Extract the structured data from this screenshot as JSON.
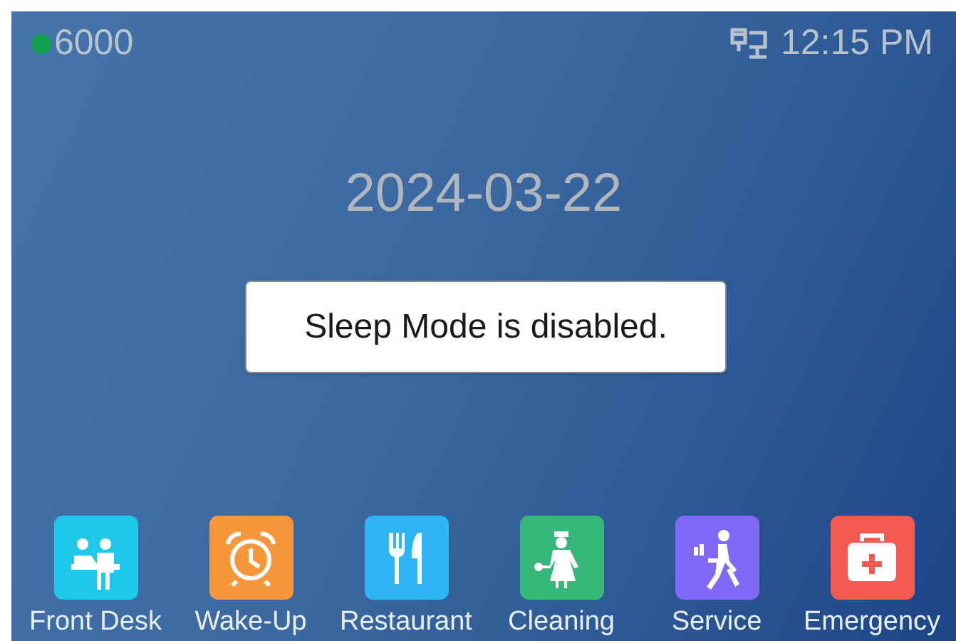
{
  "status_bar": {
    "registered": true,
    "extension": "6000",
    "time": "12:15 PM"
  },
  "date": "2024-03-22",
  "toast": "Sleep Mode is disabled.",
  "apps": [
    {
      "kind": "front-desk",
      "label": "Front Desk",
      "color": "#1ec8e8"
    },
    {
      "kind": "wake-up",
      "label": "Wake-Up",
      "color": "#f8973a"
    },
    {
      "kind": "restaurant",
      "label": "Restaurant",
      "color": "#2fb4f8"
    },
    {
      "kind": "cleaning",
      "label": "Cleaning",
      "color": "#34b87a"
    },
    {
      "kind": "service",
      "label": "Service",
      "color": "#7f6af8"
    },
    {
      "kind": "emergency",
      "label": "Emergency",
      "color": "#f45a50"
    }
  ]
}
